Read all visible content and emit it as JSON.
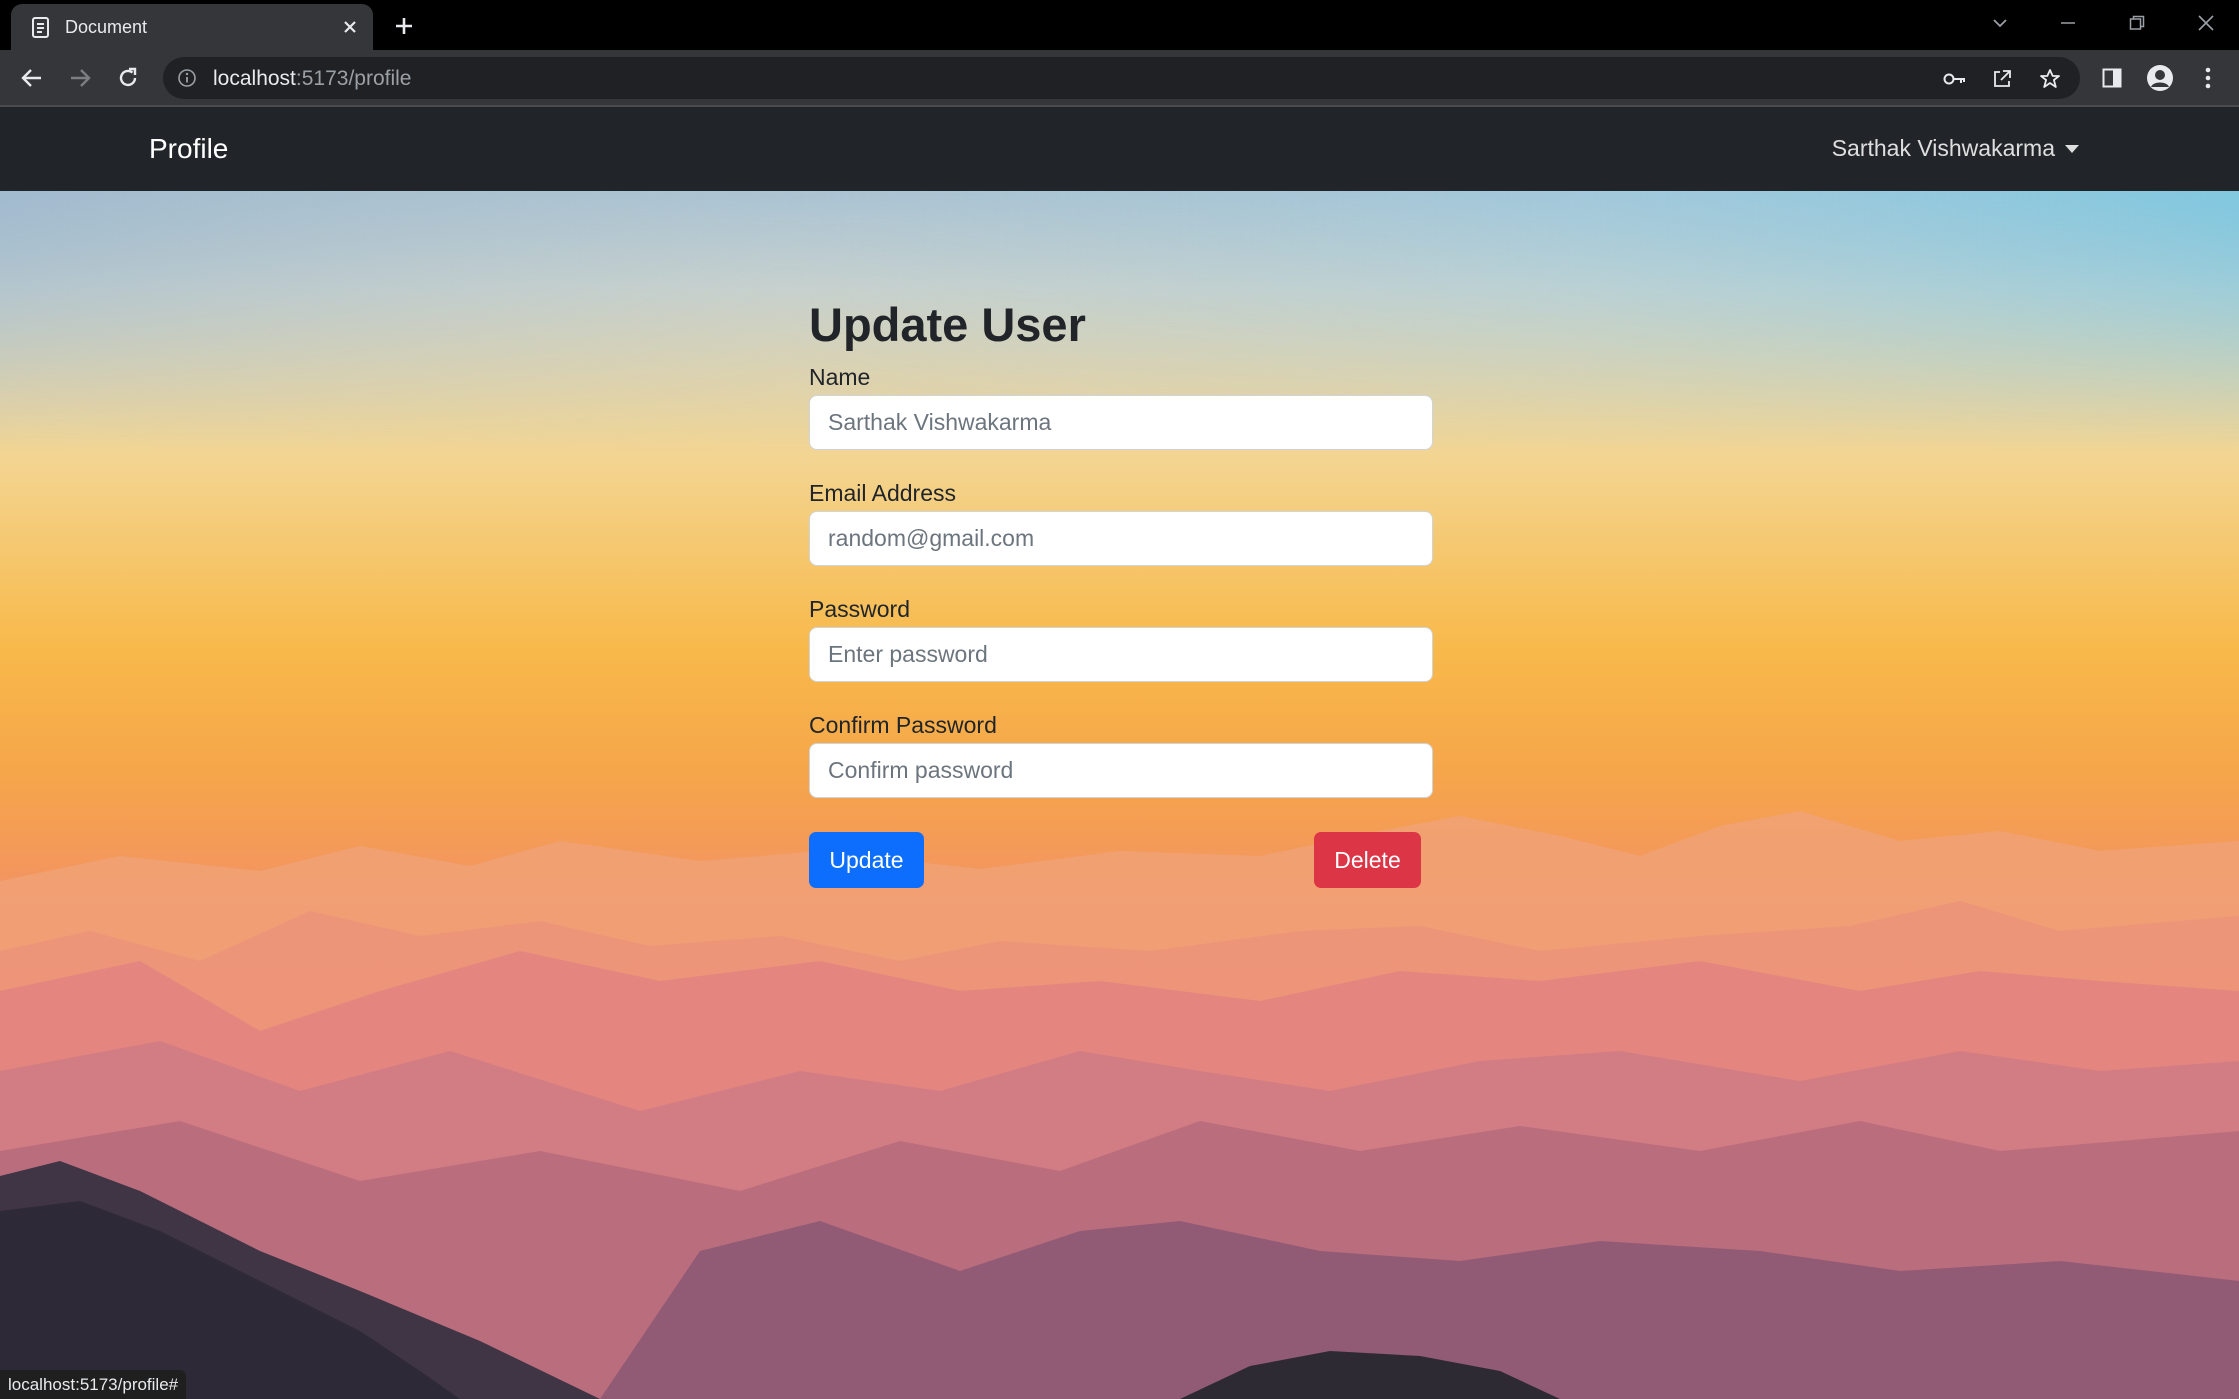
{
  "browser": {
    "tab": {
      "title": "Document",
      "favicon": "document-favicon-icon"
    },
    "url": {
      "host": "localhost",
      "rest": ":5173/profile"
    },
    "status_url": "localhost:5173/profile#"
  },
  "navbar": {
    "brand": "Profile",
    "user_name": "Sarthak Vishwakarma"
  },
  "form": {
    "title": "Update User",
    "fields": [
      {
        "label": "Name",
        "value": "",
        "placeholder": "Sarthak Vishwakarma"
      },
      {
        "label": "Email Address",
        "value": "",
        "placeholder": "random@gmail.com"
      },
      {
        "label": "Password",
        "value": "",
        "placeholder": "Enter password"
      },
      {
        "label": "Confirm Password",
        "value": "",
        "placeholder": "Confirm password"
      }
    ],
    "update_label": "Update",
    "delete_label": "Delete"
  },
  "colors": {
    "navbar": "#212529",
    "primary": "#0d6efd",
    "danger": "#dc3545"
  }
}
